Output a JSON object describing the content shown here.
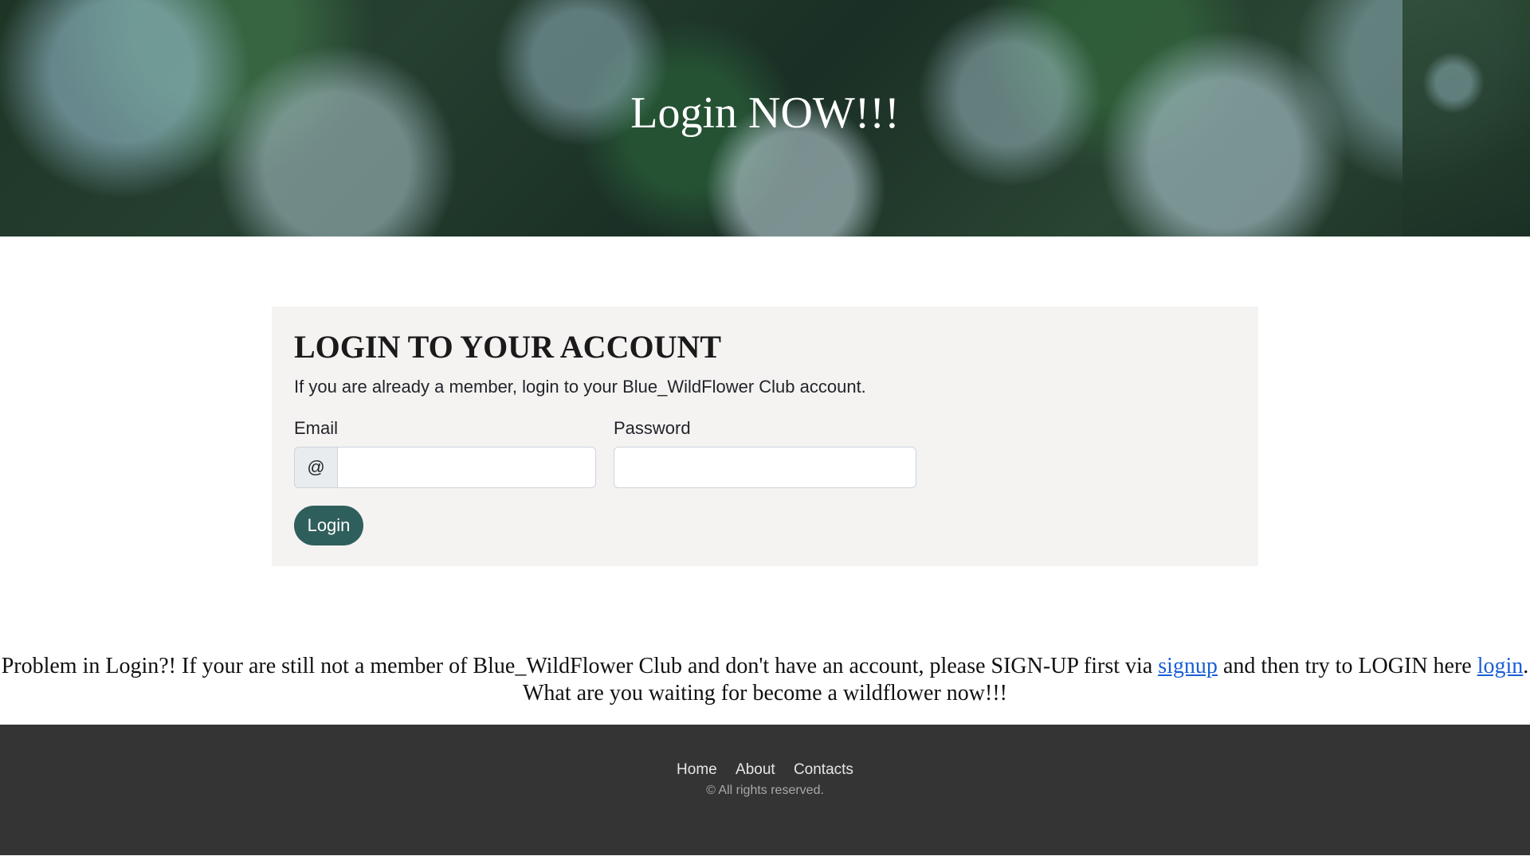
{
  "hero": {
    "title": "Login NOW!!!"
  },
  "login_card": {
    "heading": "LOGIN TO YOUR ACCOUNT",
    "intro": "If you are already a member, login to your Blue_WildFlower Club account.",
    "email_label": "Email",
    "email_prefix": "@",
    "email_value": "",
    "password_label": "Password",
    "password_value": "",
    "button_label": "Login",
    "button_color": "#2f5f5c"
  },
  "help": {
    "line1_before": "Problem in Login?! If your are still not a member of Blue_WildFlower Club and don't have an account, please SIGN-UP first via ",
    "signup_link": "signup",
    "line1_middle": " and then try to LOGIN here ",
    "login_link": "login",
    "line1_end": ".",
    "line2": "What are you waiting for become a wildflower now!!!"
  },
  "footer": {
    "nav": [
      "Home",
      "About",
      "Contacts"
    ],
    "copyright": "© All rights reserved."
  }
}
